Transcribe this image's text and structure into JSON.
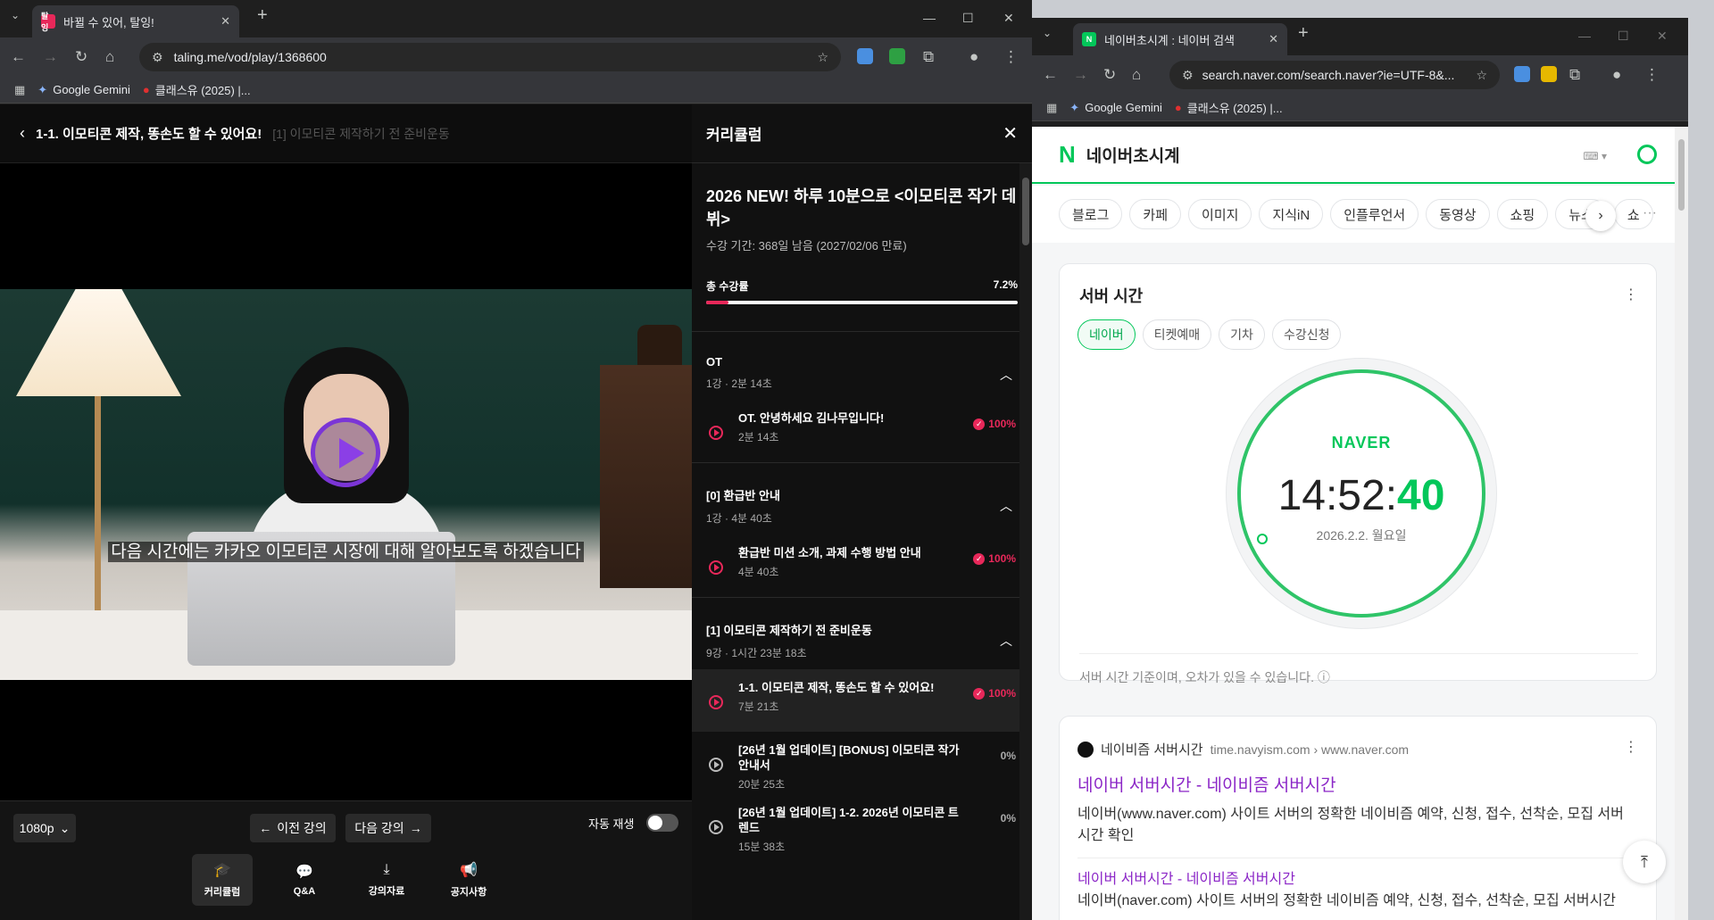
{
  "left_window": {
    "tab": {
      "title": "바뀔 수 있어, 탈잉!",
      "favicon_text": "탈잉",
      "favicon_color": "#e8285a"
    },
    "address": "taling.me/vod/play/1368600",
    "bookmarks": [
      "Google Gemini",
      "클래스유 (2025) |..."
    ],
    "player": {
      "title": "1-1. 이모티콘 제작, 똥손도 할 수 있어요!",
      "subtitle": "[1] 이모티콘 제작하기 전 준비운동",
      "caption": "다음 시간에는 카카오 이모티콘 시장에 대해 알아보도록 하겠습니다",
      "quality": "1080p",
      "prev_label": "이전 강의",
      "next_label": "다음 강의",
      "autoplay_label": "자동 재생",
      "bottom_nav": [
        "커리큘럼",
        "Q&A",
        "강의자료",
        "공지사항"
      ]
    },
    "curriculum": {
      "header": "커리큘럼",
      "course_title": "2026 NEW! 하루 10분으로 <이모티콘 작가 데뷔>",
      "period": "수강 기간: 368일 남음 (2027/02/06 만료)",
      "progress_label": "총 수강률",
      "progress_text": "7.2%",
      "progress_value": 0.072,
      "sections": [
        {
          "title": "OT",
          "meta": "1강 · 2분 14초",
          "lessons": [
            {
              "title": "OT. 안녕하세요 김나무입니다!",
              "duration": "2분 14초",
              "percent": "100%"
            }
          ]
        },
        {
          "title": "[0] 환급반 안내",
          "meta": "1강 · 4분 40초",
          "lessons": [
            {
              "title": "환급반 미션 소개, 과제 수행 방법 안내",
              "duration": "4분 40초",
              "percent": "100%"
            }
          ]
        },
        {
          "title": "[1] 이모티콘 제작하기 전 준비운동",
          "meta": "9강 · 1시간 23분 18초",
          "lessons": [
            {
              "title": "1-1. 이모티콘 제작, 똥손도 할 수 있어요!",
              "duration": "7분 21초",
              "percent": "100%"
            },
            {
              "title": "[26년 1월 업데이트] [BONUS] 이모티콘 작가 안내서",
              "duration": "20분 25초",
              "percent": "0%"
            },
            {
              "title": "[26년 1월 업데이트] 1-2. 2026년 이모티콘 트렌드",
              "duration": "15분 38초",
              "percent": "0%"
            }
          ]
        }
      ]
    }
  },
  "right_window": {
    "tab": {
      "title": "네이버초시계 : 네이버 검색",
      "favicon_text": "N",
      "favicon_color": "#03c75a"
    },
    "address": "search.naver.com/search.naver?ie=UTF-8&...",
    "bookmarks": [
      "Google Gemini",
      "클래스유 (2025) |..."
    ],
    "search": {
      "logo": "N",
      "query": "네이버초시계",
      "tabs": [
        "블로그",
        "카페",
        "이미지",
        "지식iN",
        "인플루언서",
        "동영상",
        "쇼핑",
        "뉴스",
        "쇼"
      ]
    },
    "server_time_card": {
      "title": "서버 시간",
      "chips": [
        "네이버",
        "티켓예매",
        "기차",
        "수강신청"
      ],
      "clock_brand": "NAVER",
      "time_hm": "14:52:",
      "time_s": "40",
      "date": "2026.2.2. 월요일",
      "note": "서버 시간 기준이며, 오차가 있을 수 있습니다."
    },
    "result": {
      "site_name": "네이비즘 서버시간",
      "site_domain": "time.navyism.com › www.naver.com",
      "title": "네이버 서버시간 - 네이비즘 서버시간",
      "desc": "네이버(www.naver.com) 사이트 서버의 정확한 네이비즘 예약, 신청, 접수, 선착순, 모집 서버시간 확인",
      "title2": "네이버 서버시간 - 네이비즘 서버시간",
      "desc2": "네이버(naver.com) 사이트 서버의 정확한 네이비즘 예약, 신청, 접수, 선착순, 모집 서버시간"
    }
  }
}
